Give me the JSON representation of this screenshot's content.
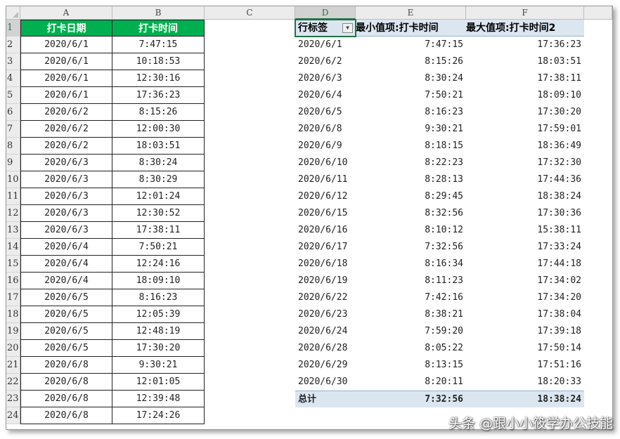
{
  "columns": [
    "A",
    "B",
    "C",
    "D",
    "E",
    "F"
  ],
  "rows": [
    "1",
    "2",
    "3",
    "4",
    "5",
    "6",
    "7",
    "8",
    "9",
    "10",
    "11",
    "12",
    "13",
    "14",
    "15",
    "16",
    "17",
    "18",
    "19",
    "20",
    "21",
    "22",
    "23",
    "24"
  ],
  "colA_header": "打卡日期",
  "colB_header": "打卡时间",
  "data_rows": [
    [
      "2020/6/1",
      "7:47:15"
    ],
    [
      "2020/6/1",
      "10:18:53"
    ],
    [
      "2020/6/1",
      "12:30:16"
    ],
    [
      "2020/6/1",
      "17:36:23"
    ],
    [
      "2020/6/2",
      "8:15:26"
    ],
    [
      "2020/6/2",
      "12:00:30"
    ],
    [
      "2020/6/2",
      "18:03:51"
    ],
    [
      "2020/6/3",
      "8:30:24"
    ],
    [
      "2020/6/3",
      "8:30:29"
    ],
    [
      "2020/6/3",
      "12:01:24"
    ],
    [
      "2020/6/3",
      "12:30:52"
    ],
    [
      "2020/6/3",
      "17:38:11"
    ],
    [
      "2020/6/4",
      "7:50:21"
    ],
    [
      "2020/6/4",
      "12:24:16"
    ],
    [
      "2020/6/4",
      "18:09:10"
    ],
    [
      "2020/6/5",
      "8:16:23"
    ],
    [
      "2020/6/5",
      "12:05:39"
    ],
    [
      "2020/6/5",
      "12:48:19"
    ],
    [
      "2020/6/5",
      "17:30:20"
    ],
    [
      "2020/6/8",
      "9:30:21"
    ],
    [
      "2020/6/8",
      "12:01:05"
    ],
    [
      "2020/6/8",
      "12:39:48"
    ],
    [
      "2020/6/8",
      "17:24:26"
    ]
  ],
  "pivot": {
    "header": {
      "row_label": "行标签",
      "min_label": "最小值项:打卡时间",
      "max_label": "最大值项:打卡时间2"
    },
    "rows": [
      [
        "2020/6/1",
        "7:47:15",
        "17:36:23"
      ],
      [
        "2020/6/2",
        "8:15:26",
        "18:03:51"
      ],
      [
        "2020/6/3",
        "8:30:24",
        "17:38:11"
      ],
      [
        "2020/6/4",
        "7:50:21",
        "18:09:10"
      ],
      [
        "2020/6/5",
        "8:16:23",
        "17:30:20"
      ],
      [
        "2020/6/8",
        "9:30:21",
        "17:59:01"
      ],
      [
        "2020/6/9",
        "8:18:15",
        "18:36:49"
      ],
      [
        "2020/6/10",
        "8:22:23",
        "17:32:30"
      ],
      [
        "2020/6/11",
        "8:28:13",
        "17:44:36"
      ],
      [
        "2020/6/12",
        "8:29:45",
        "18:38:24"
      ],
      [
        "2020/6/15",
        "8:32:56",
        "17:30:36"
      ],
      [
        "2020/6/16",
        "8:10:12",
        "15:38:11"
      ],
      [
        "2020/6/17",
        "7:32:56",
        "17:33:24"
      ],
      [
        "2020/6/18",
        "8:16:34",
        "17:44:18"
      ],
      [
        "2020/6/19",
        "8:11:23",
        "17:34:02"
      ],
      [
        "2020/6/22",
        "7:42:16",
        "17:34:20"
      ],
      [
        "2020/6/23",
        "8:38:21",
        "17:38:04"
      ],
      [
        "2020/6/24",
        "7:59:20",
        "17:39:18"
      ],
      [
        "2020/6/28",
        "8:05:22",
        "17:50:14"
      ],
      [
        "2020/6/29",
        "8:13:15",
        "17:51:16"
      ],
      [
        "2020/6/30",
        "8:20:11",
        "18:20:33"
      ]
    ],
    "total": [
      "总计",
      "7:32:56",
      "18:38:24"
    ]
  },
  "filter_icon": "dropdown-filter-icon",
  "selected_cell": "D1",
  "watermark": "头条 @跟小小筱学办公技能",
  "colors": {
    "header_green": "#00b050",
    "pivot_blue": "#dce6f1",
    "select_green": "#217346"
  }
}
